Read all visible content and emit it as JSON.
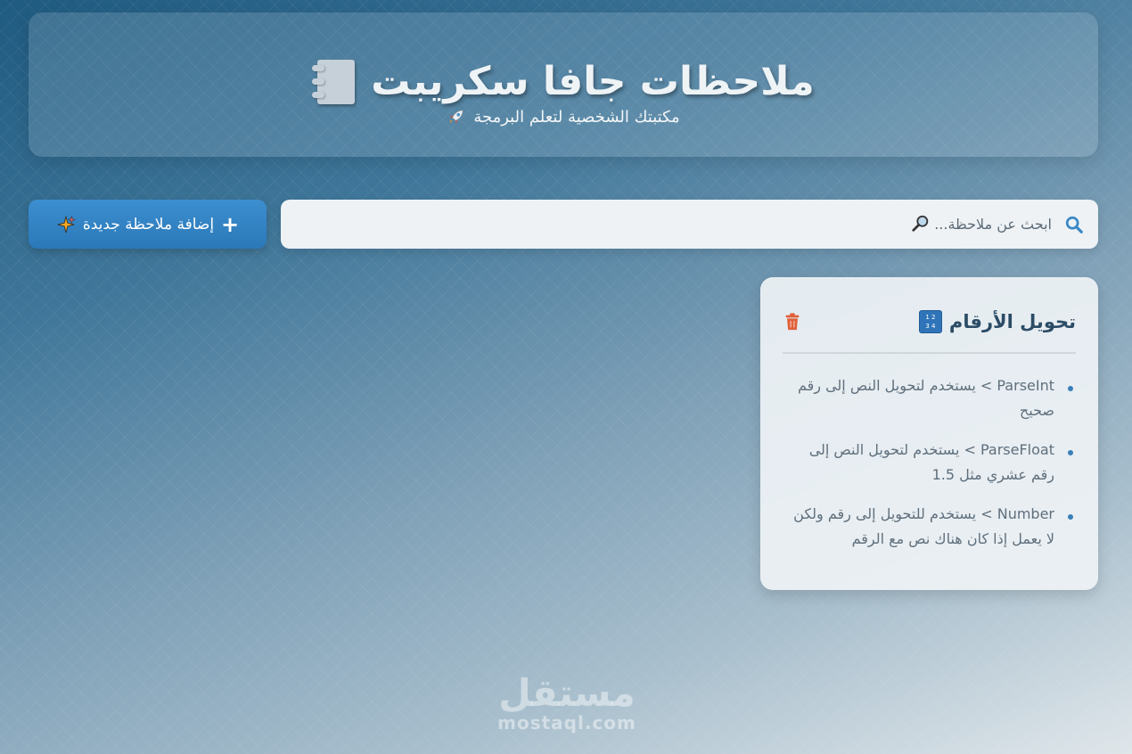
{
  "header": {
    "title": "ملاحظات جافا سكريبت",
    "subtitle": "مكتبتك الشخصية لتعلم البرمجة",
    "title_icon": "notebook-icon",
    "subtitle_icon": "rocket-icon"
  },
  "search": {
    "placeholder": "ابحث عن ملاحظة...",
    "icon": "search-icon",
    "emoji_icon": "magnifier-icon"
  },
  "add_button": {
    "label": "إضافة ملاحظة جديدة",
    "icon": "plus-icon",
    "emoji_icon": "sparkle-icon",
    "color": "#2f80c2"
  },
  "notes": [
    {
      "title": "تحويل الأرقام",
      "title_icon": "numbers-icon",
      "delete_icon": "trash-icon",
      "items": [
        "ParseInt > يستخدم لتحويل النص إلى رقم صحيح",
        "ParseFloat > يستخدم لتحويل النص إلى رقم عشري مثل 1.5",
        "Number > يستخدم للتحويل إلى رقم ولكن لا يعمل إذا كان هناك نص مع الرقم"
      ]
    }
  ],
  "watermark": {
    "arabic": "مستقل",
    "latin": "mostaql.com"
  },
  "colors": {
    "accent": "#2f80c2",
    "delete": "#e0603a",
    "card_title": "#2c4c66"
  }
}
